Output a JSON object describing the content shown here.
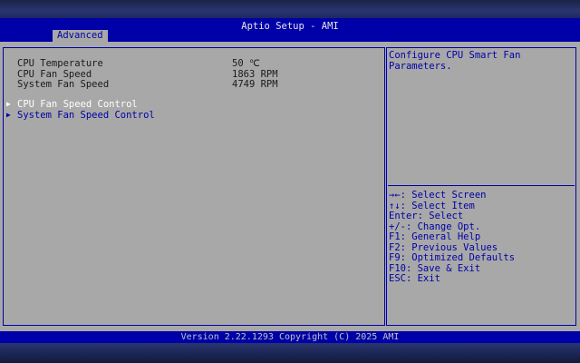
{
  "header": {
    "title": "Aptio Setup - AMI",
    "tab": "Advanced"
  },
  "info_rows": [
    {
      "label": "CPU Temperature",
      "value": "50 ℃"
    },
    {
      "label": "CPU Fan Speed",
      "value": "1863 RPM"
    },
    {
      "label": "System Fan Speed",
      "value": "4749 RPM"
    }
  ],
  "menu_items": [
    {
      "label": "CPU Fan Speed Control",
      "selected": true
    },
    {
      "label": "System Fan Speed Control",
      "selected": false
    }
  ],
  "help": {
    "text": "Configure CPU Smart Fan\nParameters."
  },
  "key_legend": [
    "→←: Select Screen",
    "↑↓: Select Item",
    "Enter: Select",
    "+/-: Change Opt.",
    "F1: General Help",
    "F2: Previous Values",
    "F9: Optimized Defaults",
    "F10: Save & Exit",
    "ESC: Exit"
  ],
  "footer": {
    "version": "Version 2.22.1293 Copyright (C) 2025 AMI"
  },
  "colors": {
    "header_blue": "#0000a8",
    "panel_gray": "#a8a8a8",
    "selected": "#ffffff",
    "menu_blue": "#0000a8"
  },
  "icons": {
    "submenu_arrow": "triangle-right-icon"
  }
}
